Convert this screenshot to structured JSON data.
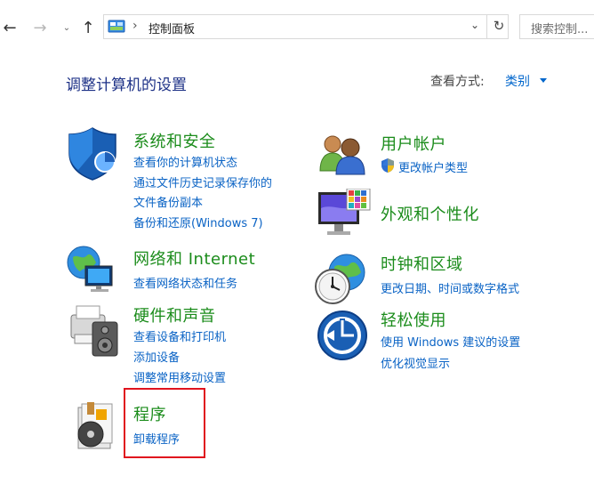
{
  "address_bar": {
    "breadcrumb": "控制面板",
    "search_placeholder": "搜索控制..."
  },
  "header": {
    "title": "调整计算机的设置",
    "view_by_label": "查看方式:",
    "view_by_value": "类别"
  },
  "categories": [
    {
      "title": "系统和安全",
      "icon": "shield-icon",
      "links": [
        "查看你的计算机状态",
        "通过文件历史记录保存你的",
        "文件备份副本",
        "备份和还原(Windows 7)"
      ]
    },
    {
      "title": "网络和 Internet",
      "icon": "network-globe-icon",
      "links": [
        "查看网络状态和任务"
      ]
    },
    {
      "title": "硬件和声音",
      "icon": "printer-icon",
      "links": [
        "查看设备和打印机",
        "添加设备",
        "调整常用移动设置"
      ]
    },
    {
      "title": "程序",
      "icon": "programs-disc-icon",
      "links": [
        "卸载程序"
      ]
    },
    {
      "title": "用户帐户",
      "icon": "users-icon",
      "links": [
        "更改帐户类型"
      ]
    },
    {
      "title": "外观和个性化",
      "icon": "monitor-icon",
      "links": []
    },
    {
      "title": "时钟和区域",
      "icon": "clock-globe-icon",
      "links": [
        "更改日期、时间或数字格式"
      ]
    },
    {
      "title": "轻松使用",
      "icon": "ease-of-access-icon",
      "links": [
        "使用 Windows 建议的设置",
        "优化视觉显示"
      ]
    }
  ],
  "colors": {
    "category_title": "#1b8c1b",
    "link": "#0a63c5",
    "page_title": "#1e3287",
    "highlight_box": "#e0141e"
  }
}
